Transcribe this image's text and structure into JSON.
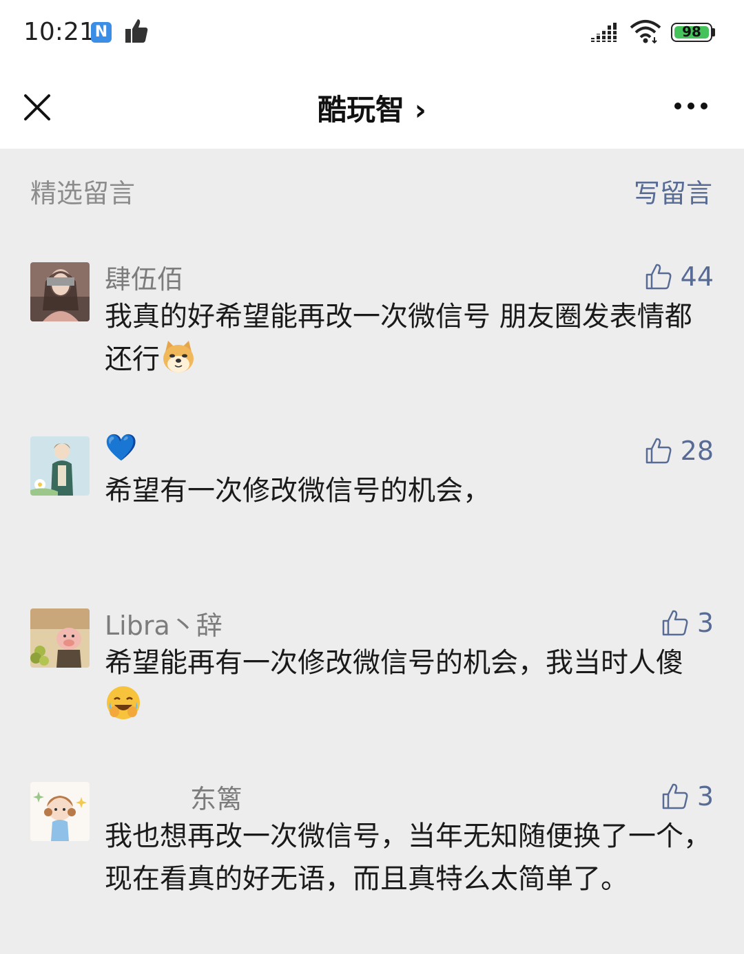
{
  "status_bar": {
    "time": "10:21",
    "app_icon_letter": "N",
    "battery": "98",
    "battery_color": "#46c25a"
  },
  "nav": {
    "title": "酷玩智 ›"
  },
  "section": {
    "title": "精选留言",
    "write_label": "写留言",
    "link_color": "#576b95"
  },
  "comments": [
    {
      "username": "肆伍佰",
      "likes": "44",
      "text": "我真的好希望能再改一次微信号 朋友圈发表情都还行",
      "emoji": "doge-emoji"
    },
    {
      "username": "💙",
      "likes": "28",
      "text": "希望有一次修改微信号的机会，",
      "emoji": ""
    },
    {
      "username": "Libra丶辞",
      "likes": "3",
      "text": "希望能再有一次修改微信号的机会，我当时人傻",
      "emoji": "laugh-cry-emoji"
    },
    {
      "username": "东篱",
      "likes": "3",
      "text": "我也想再改一次微信号，当年无知随便换了一个，现在看真的好无语，而且真特么太简单了。",
      "emoji": ""
    }
  ]
}
